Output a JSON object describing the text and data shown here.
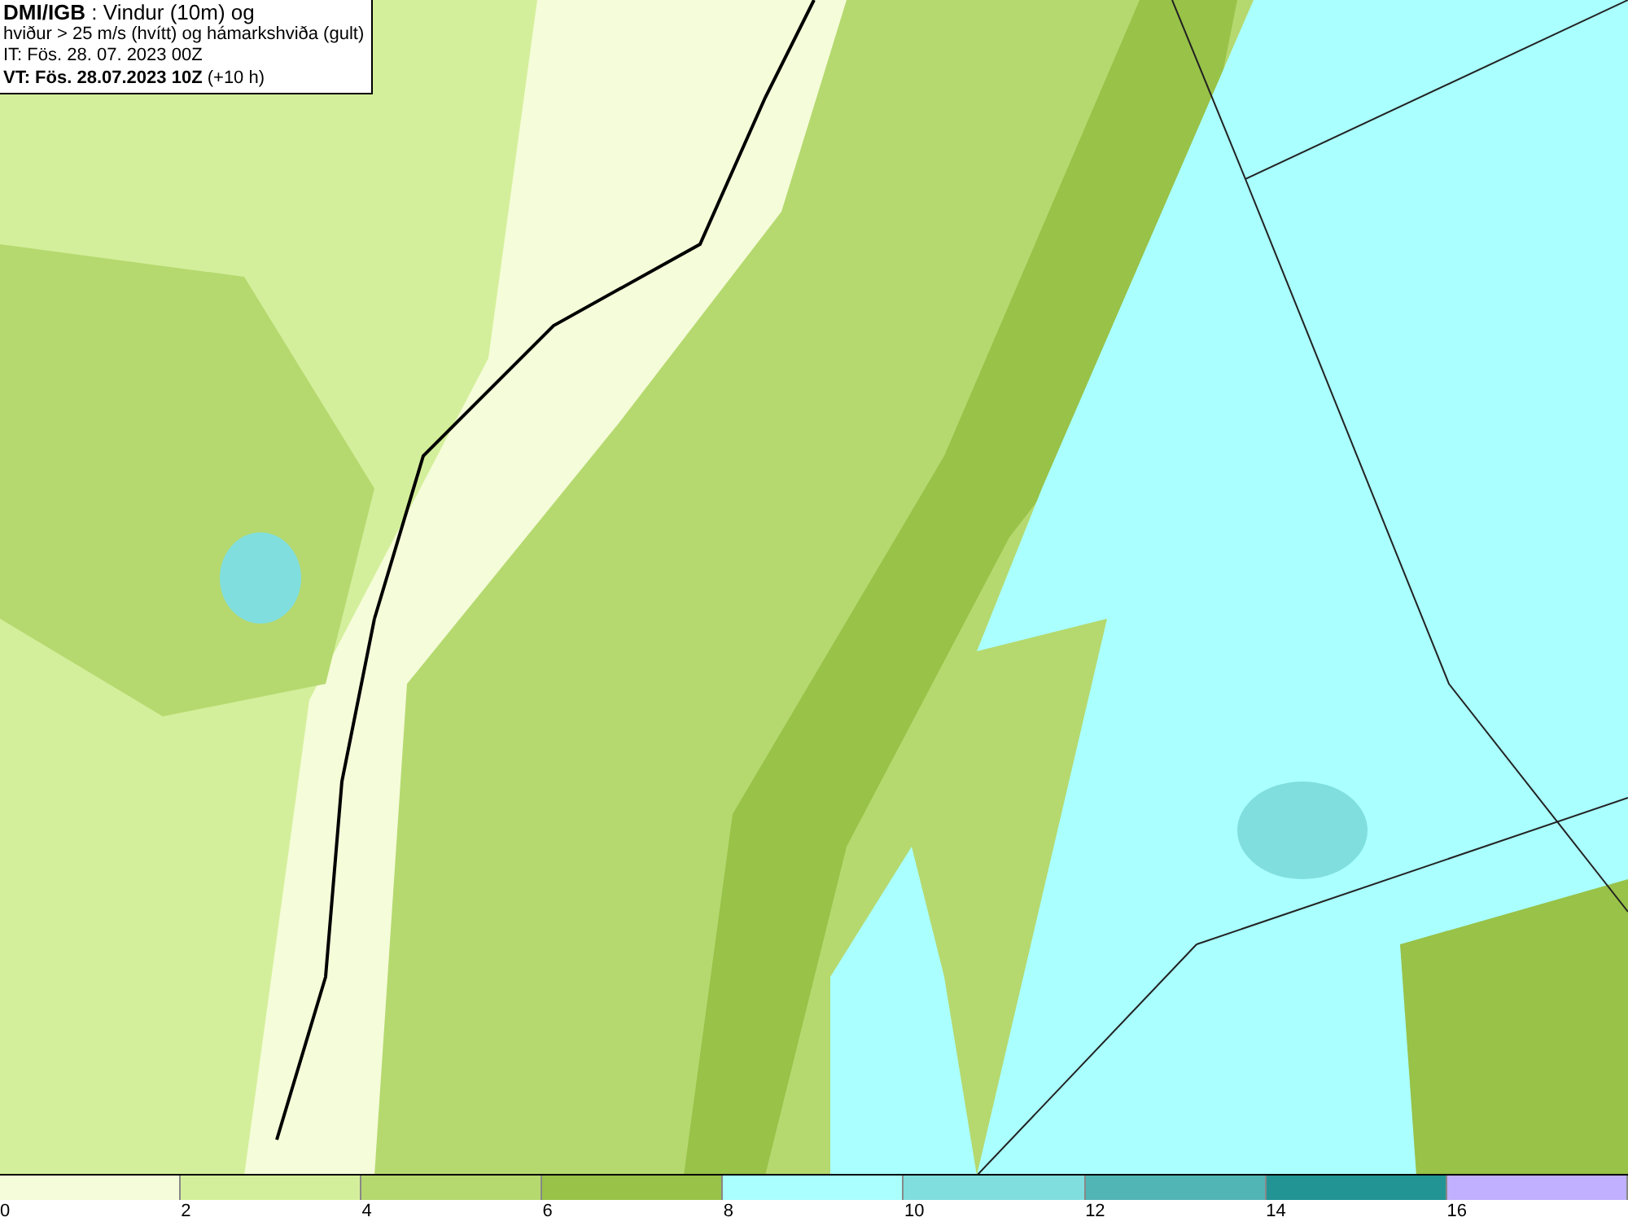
{
  "header": {
    "lines": [
      "**DMI/IGB** : Vindur (10m) og",
      "hviður > 25 m/s (hvítt) og hámarkshviða (gult)",
      "IT: Fös. 28. 07. 2023 00Z",
      "**VT: Fös. 28.07.2023 10Z** (+10 h)"
    ]
  },
  "legend": [
    {
      "label": "0",
      "color": "#f5fcd9"
    },
    {
      "label": "2",
      "color": "#d4ef9b"
    },
    {
      "label": "4",
      "color": "#b5d96f"
    },
    {
      "label": "6",
      "color": "#98c248"
    },
    {
      "label": "8",
      "color": "#aaffff"
    },
    {
      "label": "10",
      "color": "#80dede"
    },
    {
      "label": "12",
      "color": "#52b5b5"
    },
    {
      "label": "14",
      "color": "#229494"
    },
    {
      "label": "16",
      "color": "#c0b0ff"
    }
  ]
}
